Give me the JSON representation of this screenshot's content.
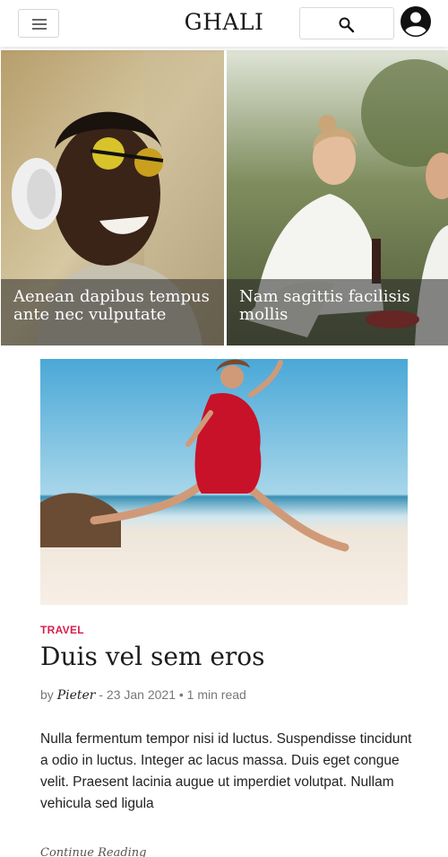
{
  "header": {
    "logo": "GHALI",
    "menu_icon": "hamburger-menu-icon",
    "search_icon": "search-icon",
    "user_icon": "account-circle-icon"
  },
  "featured": [
    {
      "caption": "Aenean dapibus tempus ante nec vulputate"
    },
    {
      "caption": "Nam sagittis facilisis mollis"
    }
  ],
  "post": {
    "category": "TRAVEL",
    "title": "Duis vel sem eros",
    "meta_by": "by",
    "author": "Pieter",
    "meta_rest": " - 23 Jan 2021 • 1 min read",
    "excerpt": "Nulla fermentum tempor nisi id luctus. Suspendisse tincidunt a odio in luctus. Integer ac lacus massa. Duis eget congue velit. Praesent lacinia augue ut imperdiet volutpat. Nullam vehicula sed ligula",
    "continue_label": "Continue Reading"
  },
  "colors": {
    "accent": "#d81e4f",
    "text": "#1d1d1d",
    "muted": "#777777"
  }
}
